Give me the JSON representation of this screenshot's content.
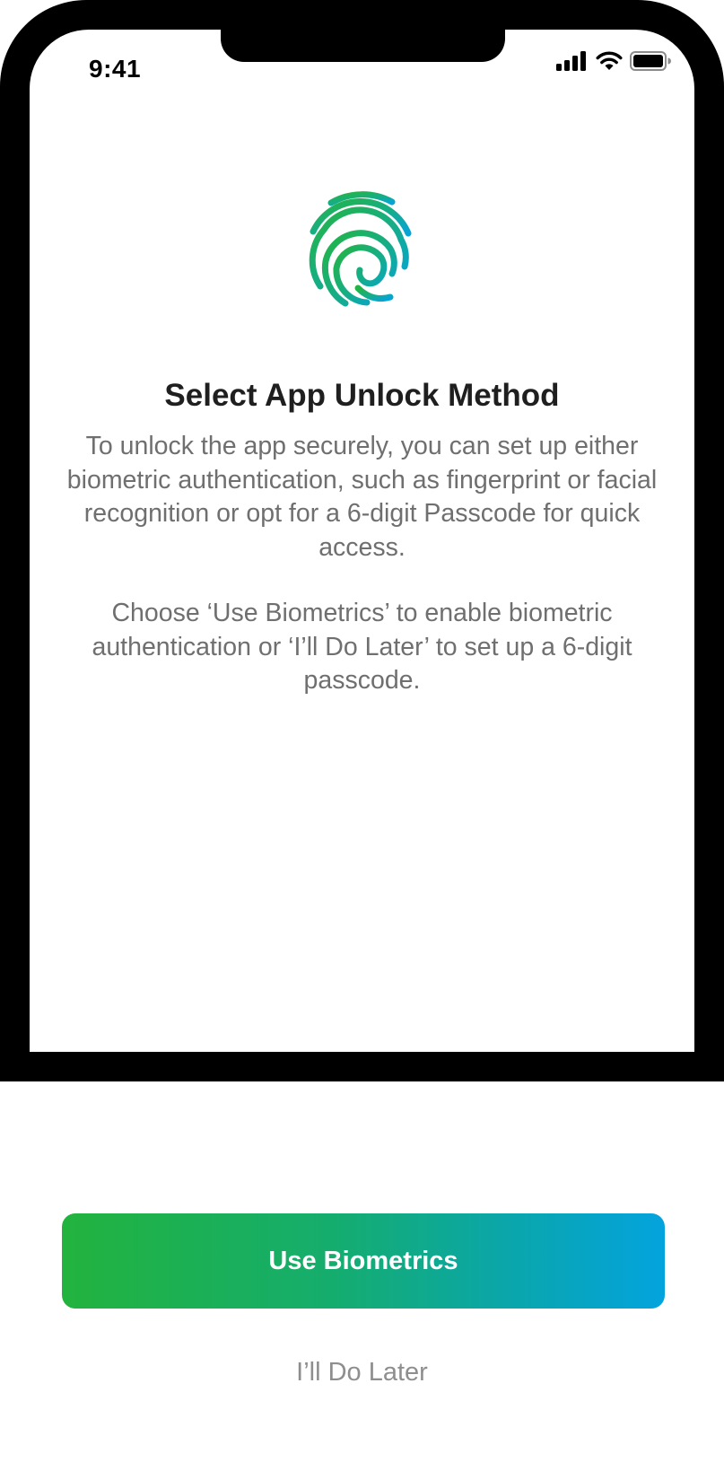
{
  "status_bar": {
    "time": "9:41",
    "icons": [
      "cellular-signal-icon",
      "wifi-icon",
      "battery-icon"
    ]
  },
  "hero": {
    "icon": "fingerprint-icon",
    "gradient_colors": [
      "#22b33e",
      "#03a3de"
    ]
  },
  "content": {
    "title": "Select App Unlock Method",
    "paragraph_1": "To unlock the app securely, you can set up either biometric authentication, such as fingerprint or facial recognition or opt for a 6-digit Passcode for quick access.",
    "paragraph_2": "Choose ‘Use Biometrics’ to enable biometric authentication or ‘I’ll Do Later’ to set up a 6-digit passcode."
  },
  "actions": {
    "primary_label": "Use Biometrics",
    "secondary_label": "I’ll Do Later"
  },
  "colors": {
    "accent_start": "#22b33e",
    "accent_end": "#03a3de",
    "title": "#1f1f1f",
    "body": "#6f6f6f",
    "secondary": "#8e8e8e",
    "frame": "#000000"
  }
}
